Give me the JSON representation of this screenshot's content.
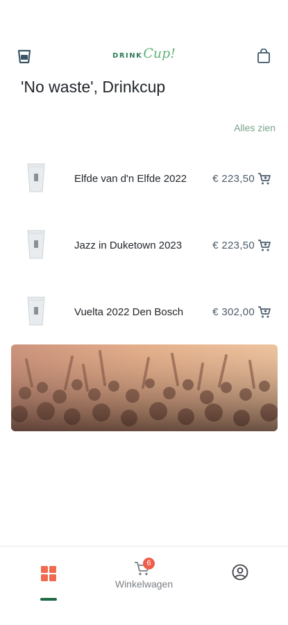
{
  "header": {
    "logo_drink": "DRINK",
    "logo_cup": "Cup!",
    "left_icon": "cup-icon",
    "right_icon": "shopping-bag-icon"
  },
  "page_title": "'No waste', Drinkcup",
  "see_all_label": "Alles zien",
  "products": [
    {
      "name": "Elfde van d'n Elfde 2022",
      "price": "€ 223,50"
    },
    {
      "name": "Jazz in Duketown 2023",
      "price": "€ 223,50"
    },
    {
      "name": "Vuelta 2022 Den Bosch",
      "price": "€ 302,00"
    }
  ],
  "banner": {
    "description_icon": "concert-crowd-image"
  },
  "bottom_nav": {
    "home_icon": "grid-icon",
    "cart_badge": "6",
    "cart_label": "Winkelwagen",
    "profile_icon": "account-circle-icon"
  },
  "colors": {
    "brand_dark": "#2e7d5a",
    "brand_light": "#5fb07a",
    "accent_orange": "#ef6a4f",
    "indicator": "#1d6b46",
    "price_text": "#4a5a6a"
  }
}
